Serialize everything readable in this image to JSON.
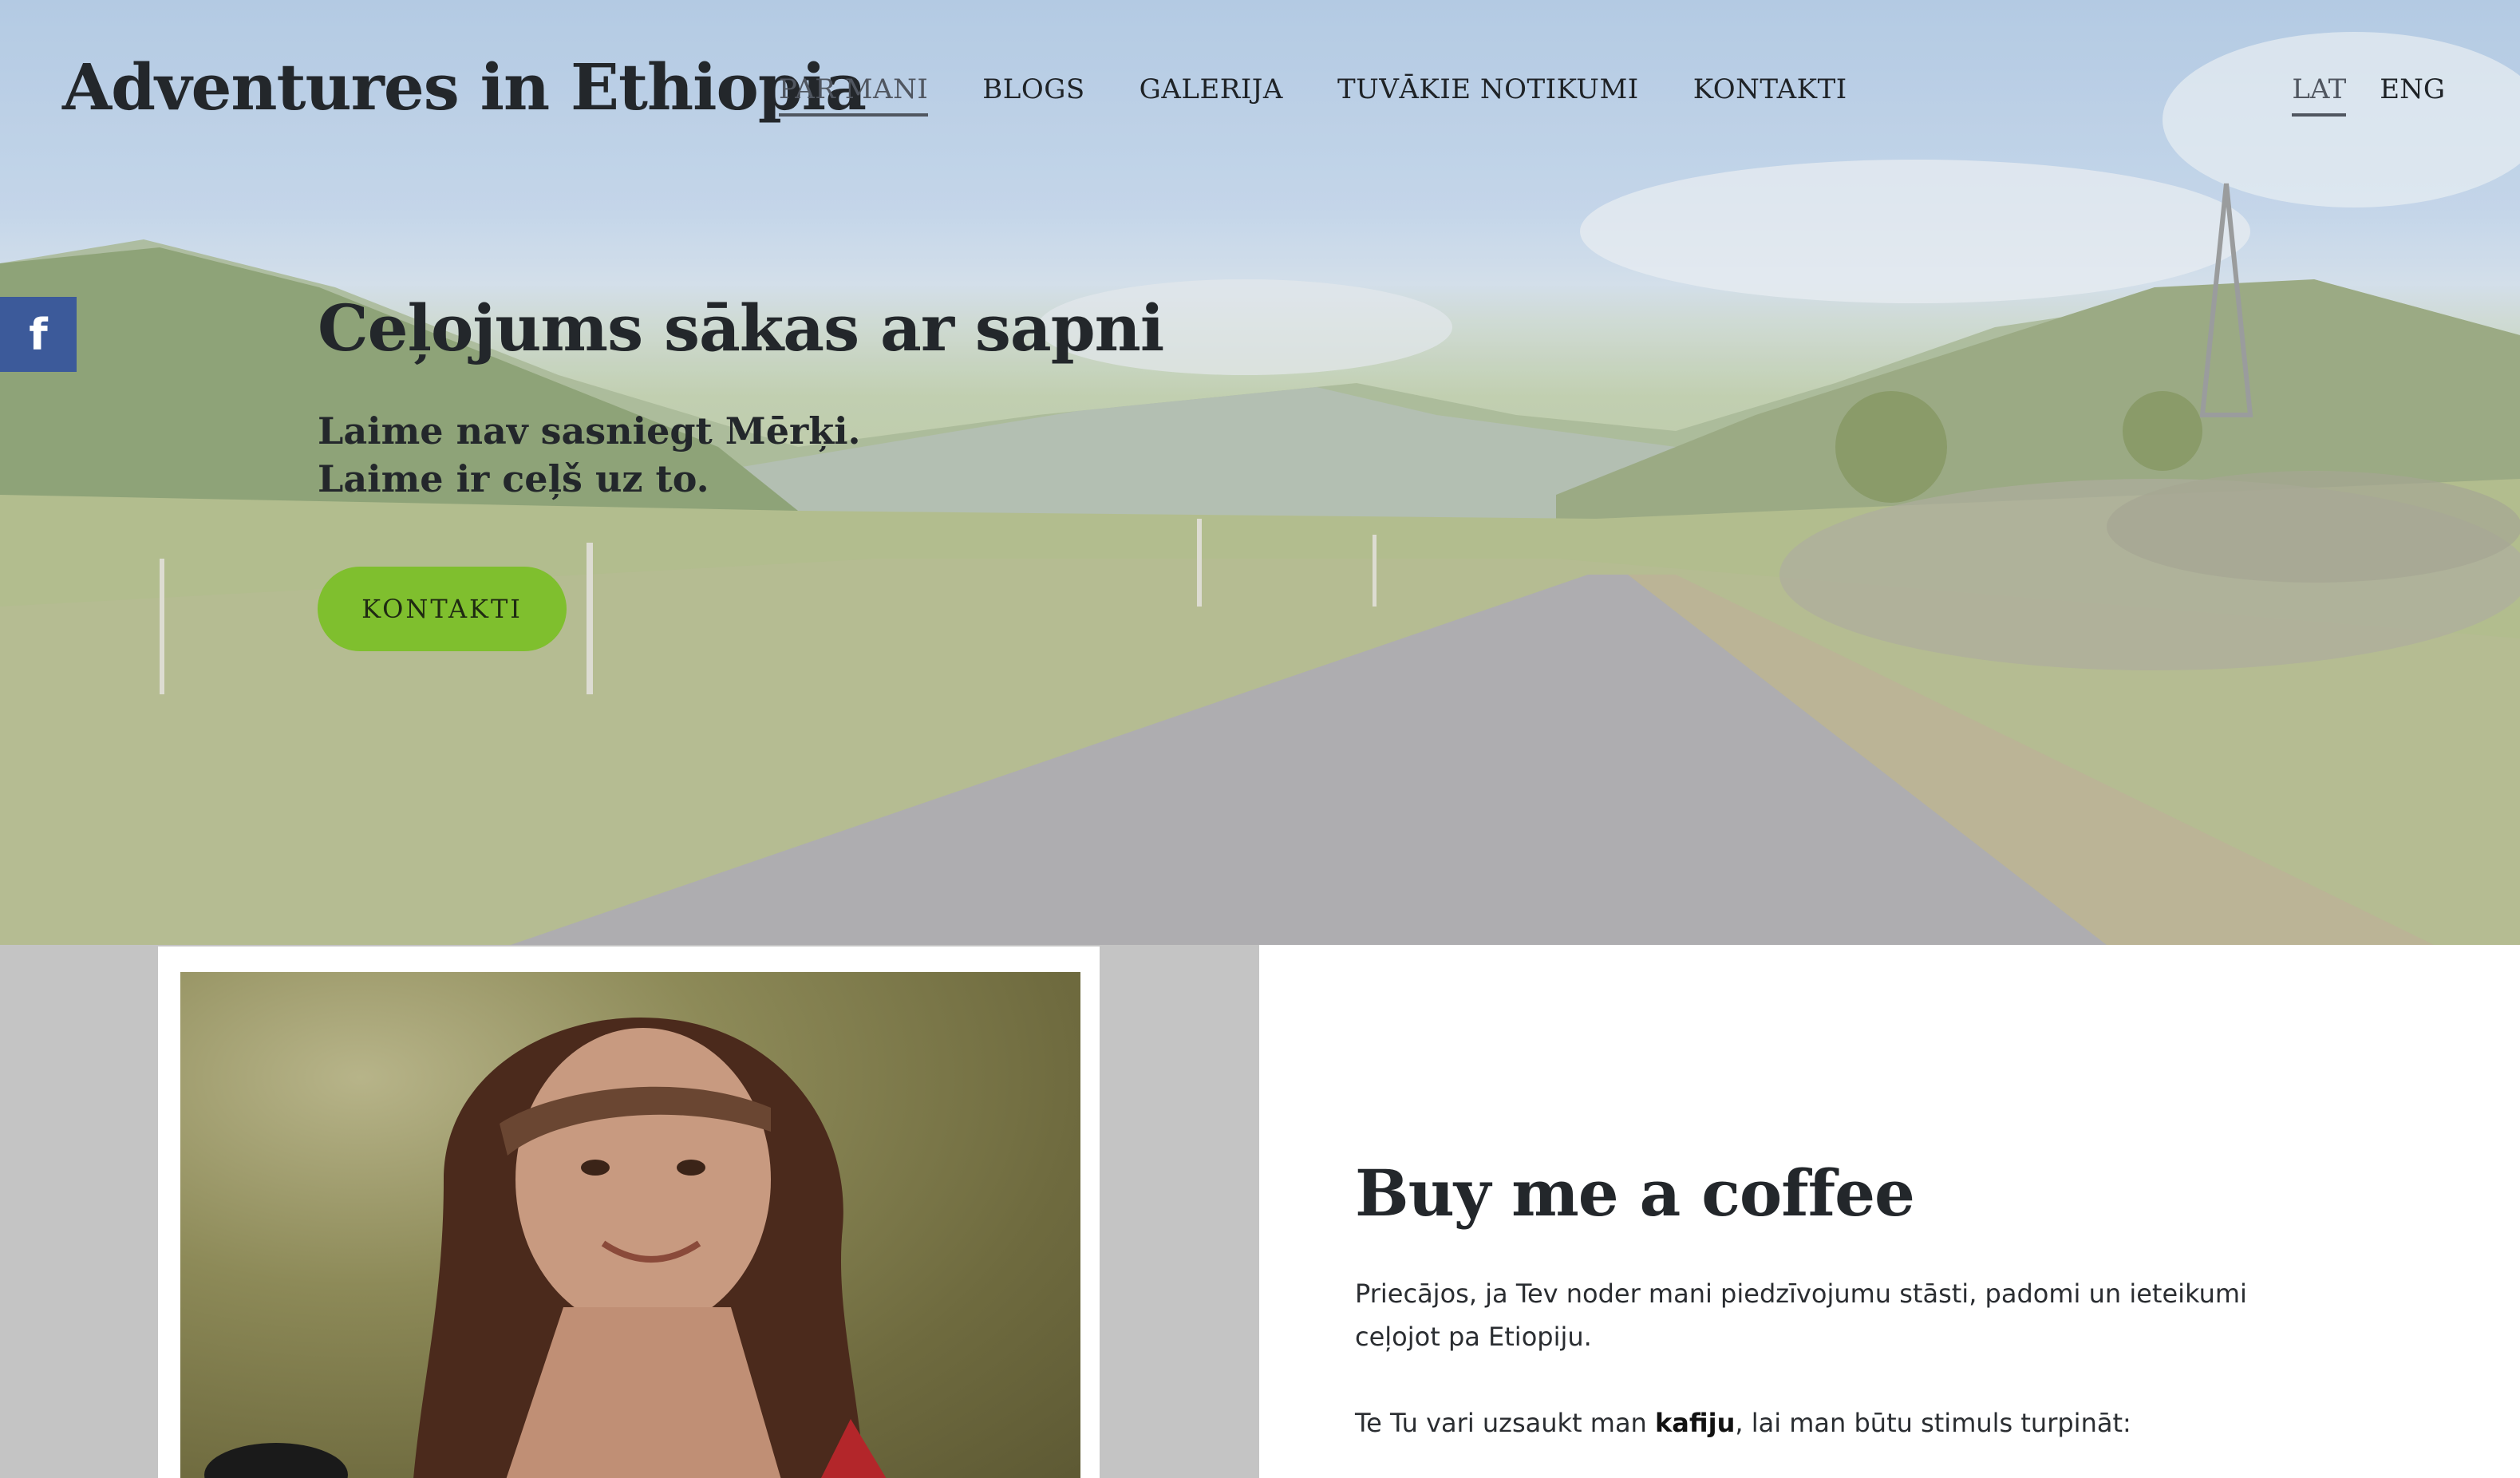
{
  "header": {
    "brand": "Adventures in Ethiopia",
    "nav": [
      {
        "label": "PAR MANI",
        "active": true
      },
      {
        "label": "BLOGS",
        "active": false
      },
      {
        "label": "GALERIJA",
        "active": false
      },
      {
        "label": "TUVĀKIE NOTIKUMI",
        "active": false
      },
      {
        "label": "KONTAKTI",
        "active": false
      }
    ],
    "languages": [
      {
        "label": "LAT",
        "active": true
      },
      {
        "label": "ENG",
        "active": false
      }
    ]
  },
  "social": {
    "facebook_glyph": "f",
    "icon": "facebook-icon",
    "color": "#3c5a9a"
  },
  "hero": {
    "title": "Ceļojums sākas ar sapni",
    "subtitle_line1": "Laime nav sasniegt Mērķi.",
    "subtitle_line2": "Laime ir ceļš uz to.",
    "button_label": "KONTAKTI",
    "button_color": "#7fbf2e"
  },
  "coffee": {
    "title": "Buy me a coffee",
    "paragraph1": "Priecājos, ja Tev noder mani piedzīvojumu stāsti, padomi un ieteikumi ceļojot pa Etiopiju.",
    "paragraph2_before": "Te Tu vari uzsaukt man ",
    "paragraph2_bold": "kafiju",
    "paragraph2_after": ", lai man būtu stimuls turpināt:"
  }
}
